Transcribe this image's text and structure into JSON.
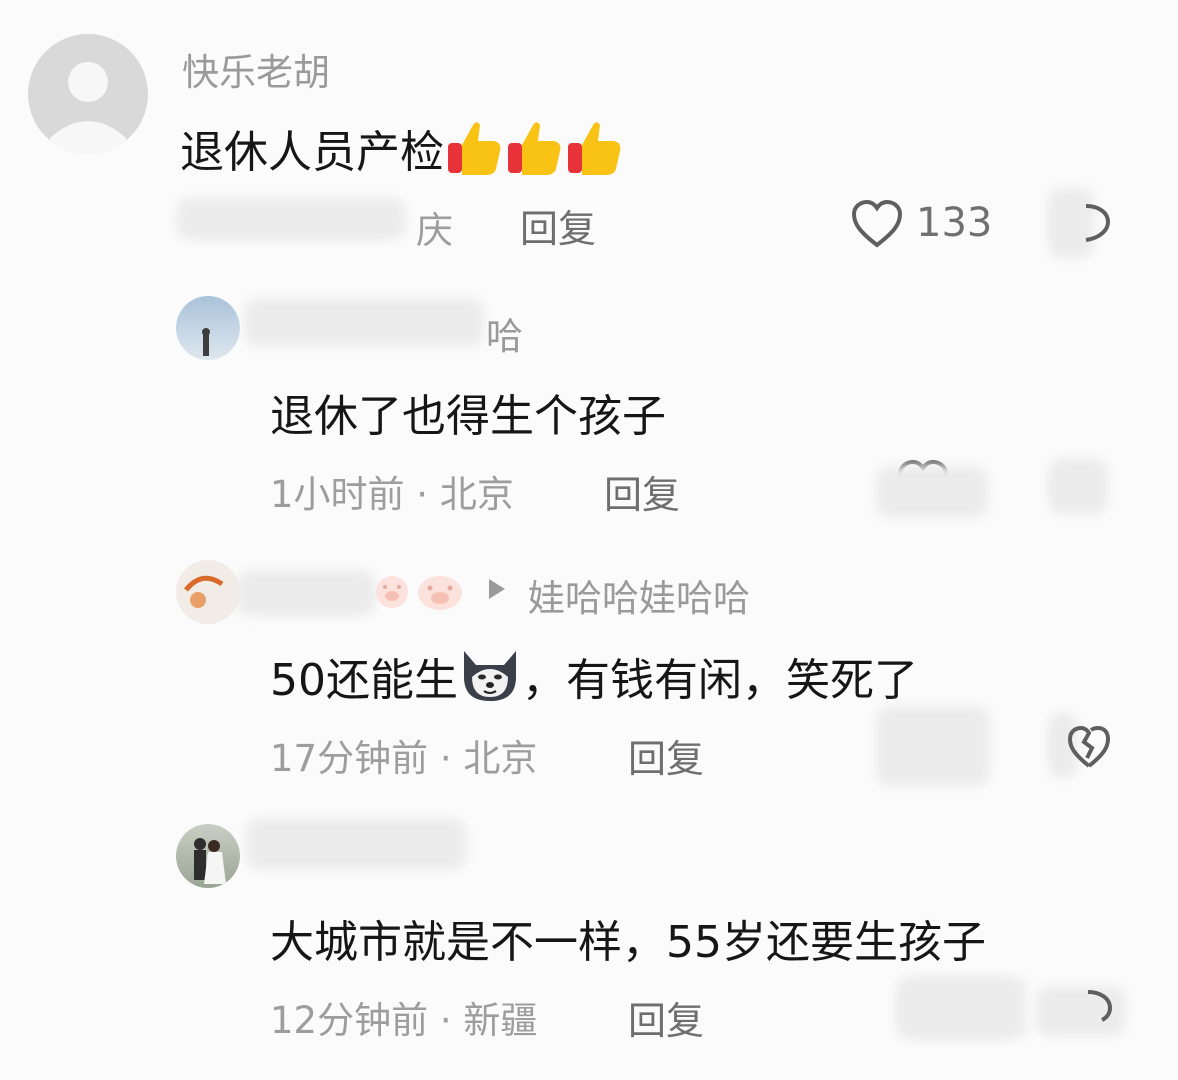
{
  "comments": [
    {
      "username": "快乐老胡",
      "text": "退休人员产检",
      "emoji": "thumbs-up",
      "location_fragment": "庆",
      "reply_label": "回复",
      "like_count": "133"
    },
    {
      "username_fragment": "哈",
      "text": "退休了也得生个孩子",
      "meta": "1小时前 · 北京",
      "reply_label": "回复"
    },
    {
      "reply_to": "娃哈哈娃哈哈",
      "text_before": "50还能生",
      "text_after": "，有钱有闲，笑死了",
      "meta": "17分钟前 · 北京",
      "reply_label": "回复"
    },
    {
      "text": "大城市就是不一样，55岁还要生孩子",
      "meta": "12分钟前 · 新疆",
      "reply_label": "回复"
    }
  ],
  "colors": {
    "background": "#fbfbfb",
    "username": "#9a9a9a",
    "comment_text": "#161616",
    "meta": "#9d9d9d",
    "reply": "#6e6e6e",
    "thumb_yellow": "#f9c316",
    "thumb_red": "#e8323a"
  }
}
